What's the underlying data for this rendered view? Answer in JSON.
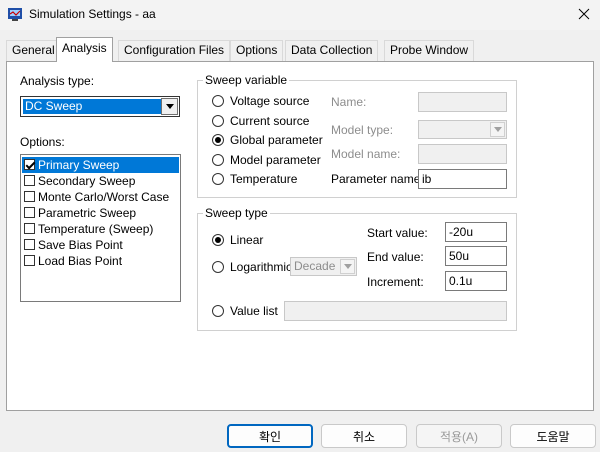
{
  "window": {
    "title": "Simulation Settings - aa"
  },
  "tabs": [
    "General",
    "Analysis",
    "Configuration Files",
    "Options",
    "Data Collection",
    "Probe Window"
  ],
  "analysis_type": {
    "label": "Analysis type:",
    "value": "DC Sweep"
  },
  "options": {
    "label": "Options:",
    "items": [
      {
        "label": "Primary Sweep",
        "checked": true
      },
      {
        "label": "Secondary Sweep",
        "checked": false
      },
      {
        "label": "Monte Carlo/Worst Case",
        "checked": false
      },
      {
        "label": "Parametric Sweep",
        "checked": false
      },
      {
        "label": "Temperature (Sweep)",
        "checked": false
      },
      {
        "label": "Save Bias Point",
        "checked": false
      },
      {
        "label": "Load Bias Point",
        "checked": false
      }
    ]
  },
  "sweep_variable": {
    "title": "Sweep variable",
    "radios": [
      "Voltage source",
      "Current source",
      "Global parameter",
      "Model parameter",
      "Temperature"
    ],
    "name_label": "Name:",
    "model_type_label": "Model type:",
    "model_name_label": "Model name:",
    "parameter_name_label": "Parameter name:",
    "parameter_name_value": "ib"
  },
  "sweep_type": {
    "title": "Sweep type",
    "linear": "Linear",
    "logarithmic": "Logarithmic",
    "log_scale": "Decade",
    "value_list": "Value list",
    "start_label": "Start value:",
    "start_value": "-20u",
    "end_label": "End value:",
    "end_value": "50u",
    "increment_label": "Increment:",
    "increment_value": "0.1u"
  },
  "buttons": {
    "ok": "확인",
    "cancel": "취소",
    "apply": "적용(A)",
    "help": "도움말"
  }
}
